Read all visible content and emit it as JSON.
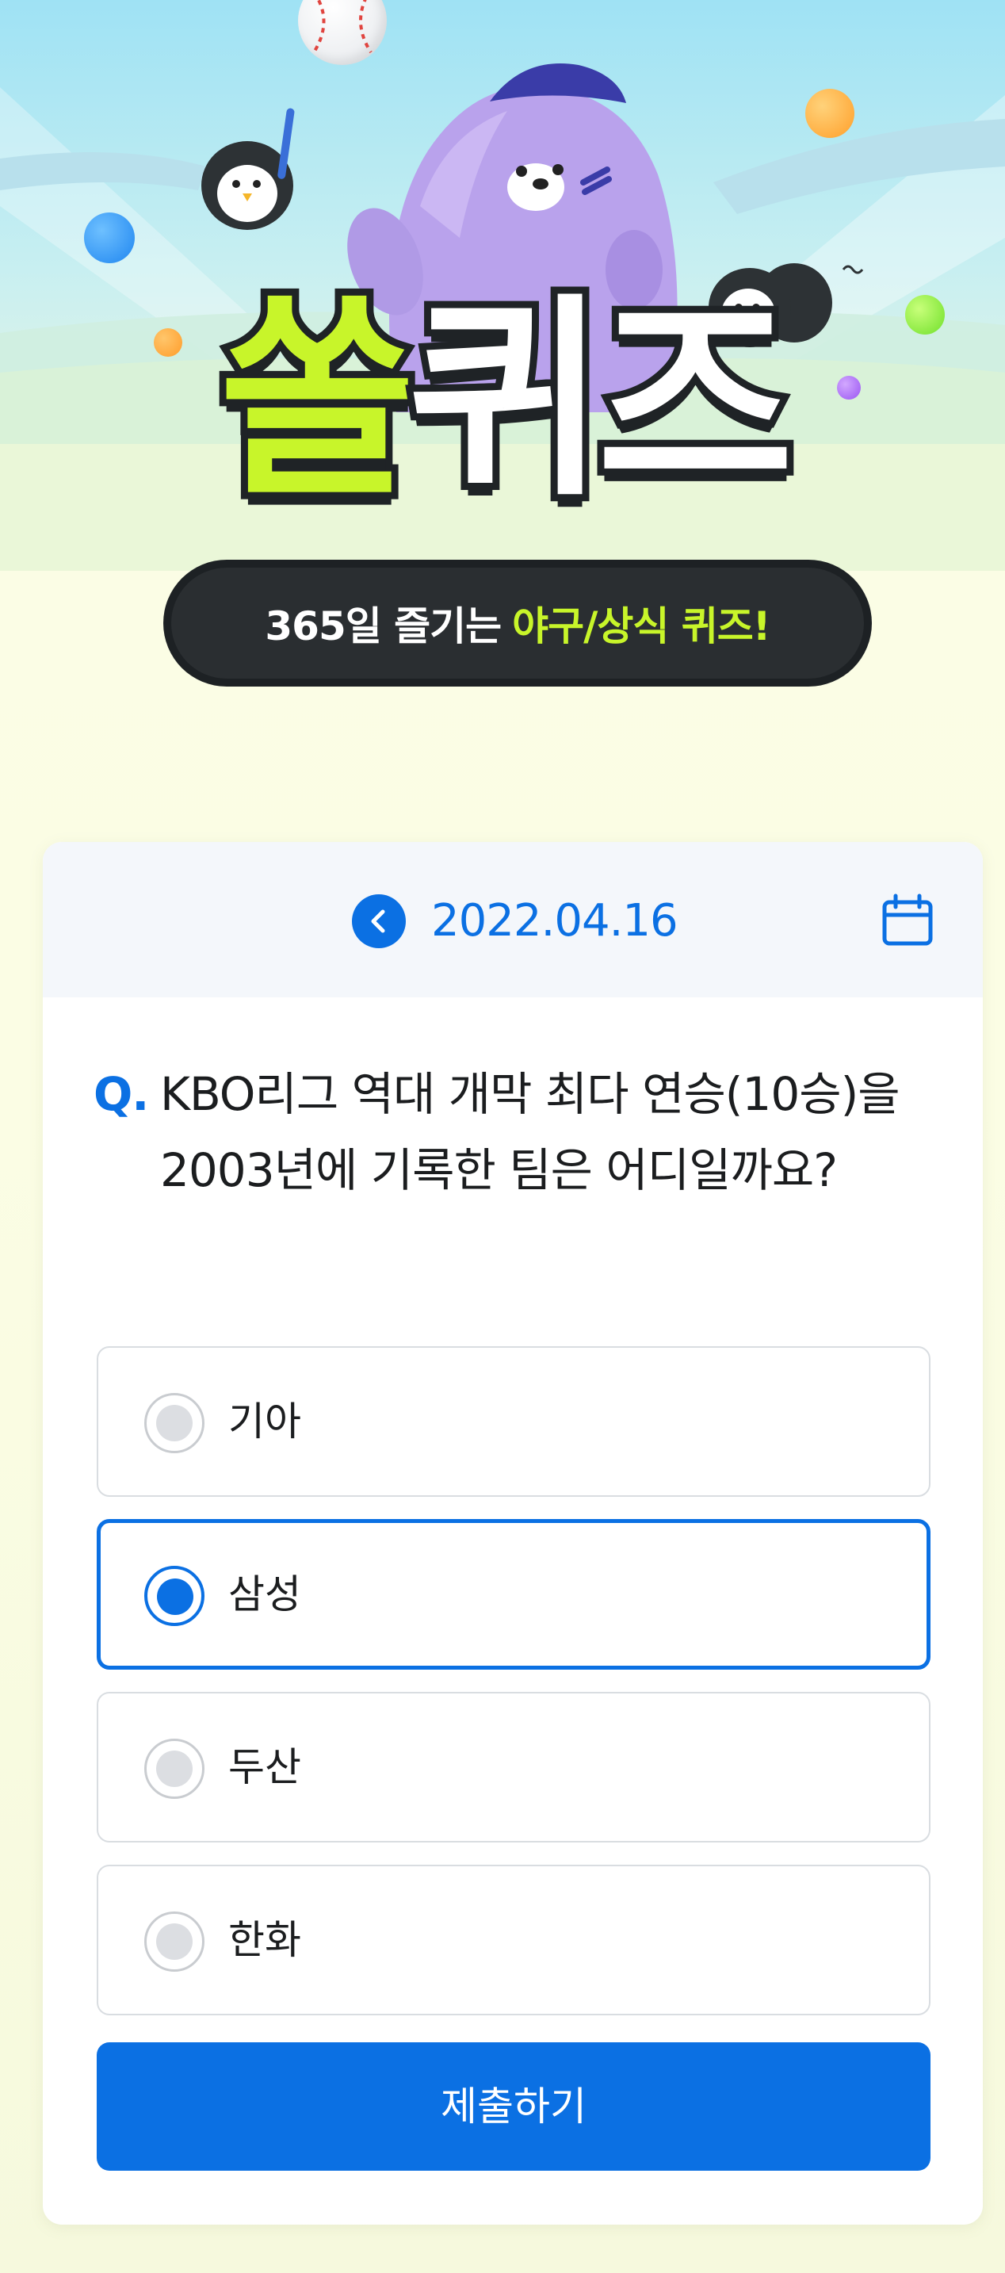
{
  "hero": {
    "logo_part1": "쏠",
    "logo_part2": "퀴즈",
    "tagline_prefix": "365일 즐기는",
    "tagline_highlight": "야구/상식 퀴즈!"
  },
  "quiz": {
    "date": "2022.04.16",
    "question_mark": "Q.",
    "question": "KBO리그 역대 개막 최다 연승(10승)을 2003년에 기록한 팀은 어디일까요?",
    "options": [
      {
        "label": "기아",
        "selected": false
      },
      {
        "label": "삼성",
        "selected": true
      },
      {
        "label": "두산",
        "selected": false
      },
      {
        "label": "한화",
        "selected": false
      }
    ],
    "submit_label": "제출하기"
  },
  "icons": {
    "prev": "chevron-left-icon",
    "calendar": "calendar-icon"
  },
  "colors": {
    "accent": "#0b70e3",
    "logo_green": "#c8f52a",
    "tagline_bg": "#2a2e31"
  }
}
